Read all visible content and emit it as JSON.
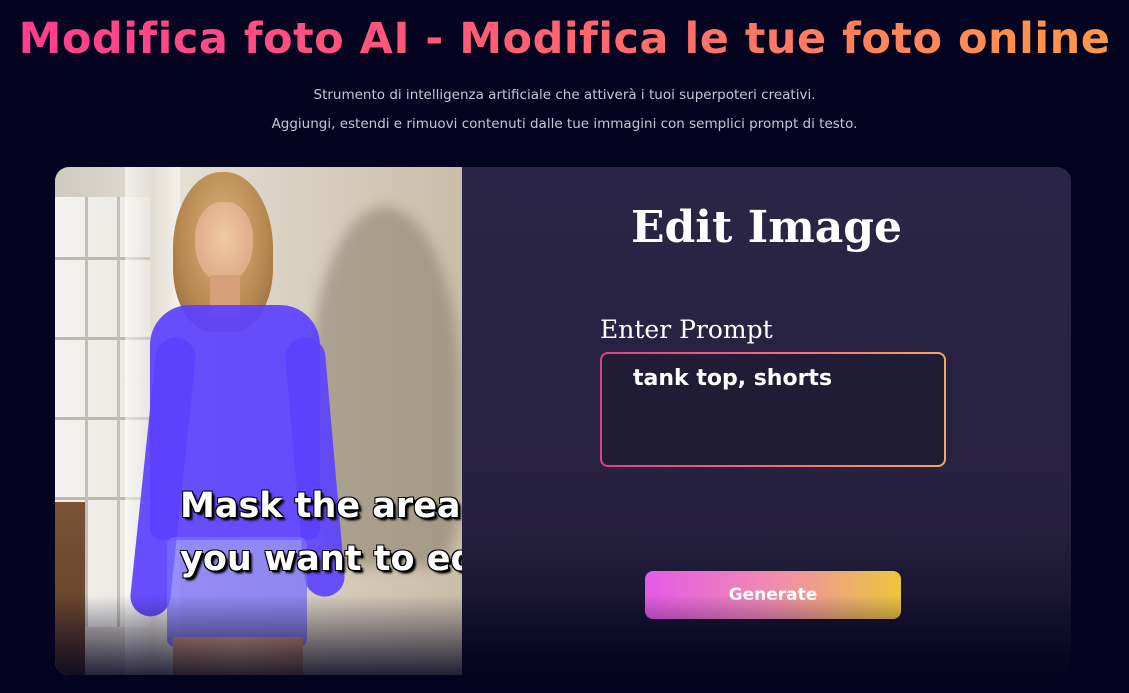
{
  "hero": {
    "title": "Modifica foto AI - Modifica le tue foto online",
    "subtitle_line1": "Strumento di intelligenza artificiale che attiverà i tuoi superpoteri creativi.",
    "subtitle_line2": "Aggiungi, estendi e rimuovi contenuti dalle tue immagini con semplici prompt di testo."
  },
  "photo_panel": {
    "caption_line1": "Mask the area",
    "caption_line2": "you want to edit",
    "mask_color": "#5c40ff"
  },
  "editor": {
    "title": "Edit Image",
    "prompt_label": "Enter Prompt",
    "prompt_value": "tank top, shorts",
    "generate_label": "Generate"
  },
  "colors": {
    "background": "#050420",
    "card": "#2a2446",
    "title_gradient": [
      "#ff3d8f",
      "#ff9a48"
    ],
    "button_gradient": [
      "#e45ae6",
      "#ecc73a"
    ]
  }
}
